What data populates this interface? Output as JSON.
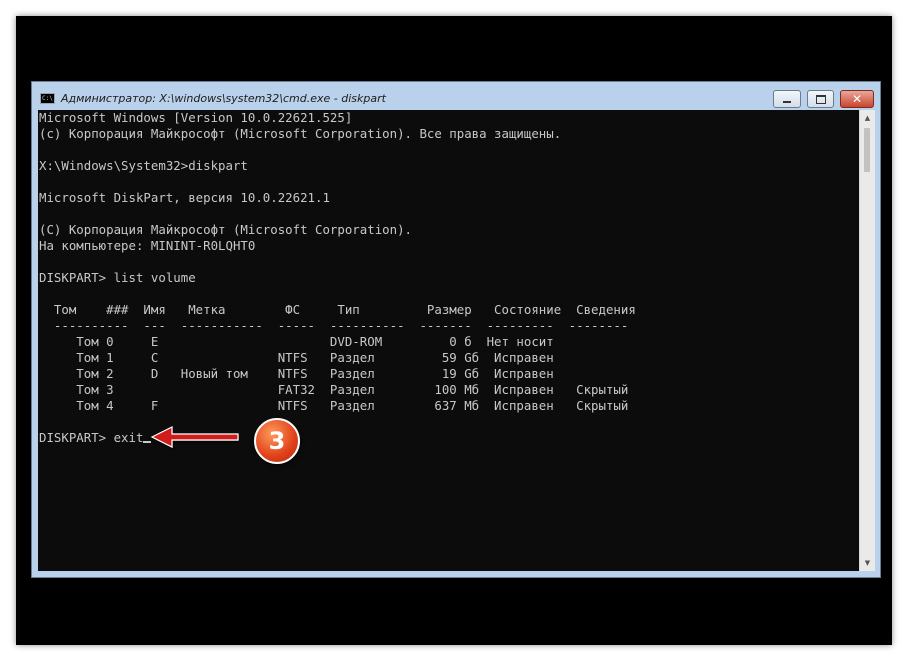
{
  "window": {
    "title": "Администратор: X:\\windows\\system32\\cmd.exe - diskpart",
    "icon_label": "C:\\"
  },
  "controls": {
    "minimize": "minimize",
    "maximize": "maximize",
    "close": "✕"
  },
  "console": {
    "lines": [
      "Microsoft Windows [Version 10.0.22621.525]",
      "(c) Корпорация Майкрософт (Microsoft Corporation). Все права защищены.",
      "",
      "X:\\Windows\\System32>diskpart",
      "",
      "Microsoft DiskPart, версия 10.0.22621.1",
      "",
      "(C) Корпорация Майкрософт (Microsoft Corporation).",
      "На компьютере: MININT-R0LQHT0",
      "",
      "DISKPART> list volume",
      "",
      "  Том    ###  Имя   Метка        ФС     Тип         Размер   Состояние  Сведения",
      "  ----------  ---  -----------  -----  ----------  -------  ---------  --------",
      "     Том 0     E                       DVD-ROM         0 б  Нет носит",
      "     Том 1     C                NTFS   Раздел         59 Gб  Исправен",
      "     Том 2     D   Новый том    NTFS   Раздел         19 Gб  Исправен",
      "     Том 3                      FAT32  Раздел        100 Мб  Исправен   Скрытый",
      "     Том 4     F                NTFS   Раздел        637 Мб  Исправен   Скрытый",
      ""
    ],
    "prompt": "DISKPART> exit"
  },
  "annotation": {
    "step": "3",
    "arrow_color": "#d11a1a",
    "badge_color": "#e5501f"
  },
  "colors": {
    "console_bg": "#0c0c0c",
    "console_text": "#c8c8c8",
    "window_frame": "#b9d1ea"
  }
}
